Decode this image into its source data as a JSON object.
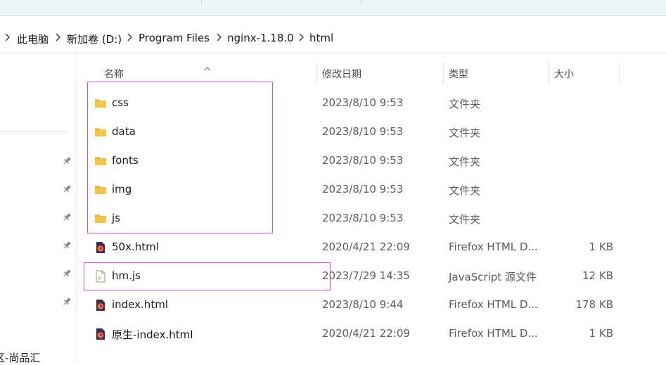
{
  "breadcrumb": [
    "此电脑",
    "新加卷 (D:)",
    "Program Files",
    "nginx-1.18.0",
    "html"
  ],
  "columns": {
    "name": "名称",
    "modified": "修改日期",
    "type": "类型",
    "size": "大小"
  },
  "files": [
    {
      "name": "css",
      "modified": "2023/8/10 9:53",
      "type": "文件夹",
      "size": "",
      "icon": "folder-icon"
    },
    {
      "name": "data",
      "modified": "2023/8/10 9:53",
      "type": "文件夹",
      "size": "",
      "icon": "folder-icon"
    },
    {
      "name": "fonts",
      "modified": "2023/8/10 9:53",
      "type": "文件夹",
      "size": "",
      "icon": "folder-icon"
    },
    {
      "name": "img",
      "modified": "2023/8/10 9:53",
      "type": "文件夹",
      "size": "",
      "icon": "folder-icon"
    },
    {
      "name": "js",
      "modified": "2023/8/10 9:53",
      "type": "文件夹",
      "size": "",
      "icon": "folder-icon"
    },
    {
      "name": "50x.html",
      "modified": "2020/4/21 22:09",
      "type": "Firefox HTML D...",
      "size": "1 KB",
      "icon": "firefox-html-icon"
    },
    {
      "name": "hm.js",
      "modified": "2023/7/29 14:35",
      "type": "JavaScript 源文件",
      "size": "12 KB",
      "icon": "javascript-file-icon"
    },
    {
      "name": "index.html",
      "modified": "2023/8/10 9:44",
      "type": "Firefox HTML D...",
      "size": "178 KB",
      "icon": "firefox-html-icon"
    },
    {
      "name": "原生-index.html",
      "modified": "2020/4/21 22:09",
      "type": "Firefox HTML D...",
      "size": "1 KB",
      "icon": "firefox-html-icon"
    }
  ],
  "nav": {
    "partial_item": "区-尚品汇"
  },
  "colors": {
    "highlight": "#d04fd6",
    "folder": "#f6c544",
    "accent_bg": "#e9f7f7"
  }
}
